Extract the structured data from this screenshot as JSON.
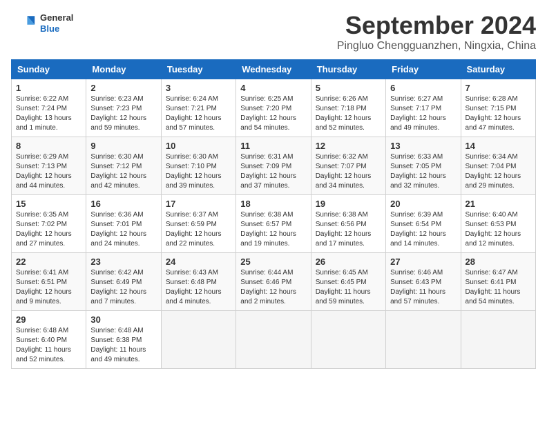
{
  "header": {
    "logo_general": "General",
    "logo_blue": "Blue",
    "title": "September 2024",
    "subtitle": "Pingluo Chengguanzhen, Ningxia, China"
  },
  "weekdays": [
    "Sunday",
    "Monday",
    "Tuesday",
    "Wednesday",
    "Thursday",
    "Friday",
    "Saturday"
  ],
  "weeks": [
    [
      {
        "day": "1",
        "sunrise": "6:22 AM",
        "sunset": "7:24 PM",
        "daylight": "13 hours and 1 minute."
      },
      {
        "day": "2",
        "sunrise": "6:23 AM",
        "sunset": "7:23 PM",
        "daylight": "12 hours and 59 minutes."
      },
      {
        "day": "3",
        "sunrise": "6:24 AM",
        "sunset": "7:21 PM",
        "daylight": "12 hours and 57 minutes."
      },
      {
        "day": "4",
        "sunrise": "6:25 AM",
        "sunset": "7:20 PM",
        "daylight": "12 hours and 54 minutes."
      },
      {
        "day": "5",
        "sunrise": "6:26 AM",
        "sunset": "7:18 PM",
        "daylight": "12 hours and 52 minutes."
      },
      {
        "day": "6",
        "sunrise": "6:27 AM",
        "sunset": "7:17 PM",
        "daylight": "12 hours and 49 minutes."
      },
      {
        "day": "7",
        "sunrise": "6:28 AM",
        "sunset": "7:15 PM",
        "daylight": "12 hours and 47 minutes."
      }
    ],
    [
      {
        "day": "8",
        "sunrise": "6:29 AM",
        "sunset": "7:13 PM",
        "daylight": "12 hours and 44 minutes."
      },
      {
        "day": "9",
        "sunrise": "6:30 AM",
        "sunset": "7:12 PM",
        "daylight": "12 hours and 42 minutes."
      },
      {
        "day": "10",
        "sunrise": "6:30 AM",
        "sunset": "7:10 PM",
        "daylight": "12 hours and 39 minutes."
      },
      {
        "day": "11",
        "sunrise": "6:31 AM",
        "sunset": "7:09 PM",
        "daylight": "12 hours and 37 minutes."
      },
      {
        "day": "12",
        "sunrise": "6:32 AM",
        "sunset": "7:07 PM",
        "daylight": "12 hours and 34 minutes."
      },
      {
        "day": "13",
        "sunrise": "6:33 AM",
        "sunset": "7:05 PM",
        "daylight": "12 hours and 32 minutes."
      },
      {
        "day": "14",
        "sunrise": "6:34 AM",
        "sunset": "7:04 PM",
        "daylight": "12 hours and 29 minutes."
      }
    ],
    [
      {
        "day": "15",
        "sunrise": "6:35 AM",
        "sunset": "7:02 PM",
        "daylight": "12 hours and 27 minutes."
      },
      {
        "day": "16",
        "sunrise": "6:36 AM",
        "sunset": "7:01 PM",
        "daylight": "12 hours and 24 minutes."
      },
      {
        "day": "17",
        "sunrise": "6:37 AM",
        "sunset": "6:59 PM",
        "daylight": "12 hours and 22 minutes."
      },
      {
        "day": "18",
        "sunrise": "6:38 AM",
        "sunset": "6:57 PM",
        "daylight": "12 hours and 19 minutes."
      },
      {
        "day": "19",
        "sunrise": "6:38 AM",
        "sunset": "6:56 PM",
        "daylight": "12 hours and 17 minutes."
      },
      {
        "day": "20",
        "sunrise": "6:39 AM",
        "sunset": "6:54 PM",
        "daylight": "12 hours and 14 minutes."
      },
      {
        "day": "21",
        "sunrise": "6:40 AM",
        "sunset": "6:53 PM",
        "daylight": "12 hours and 12 minutes."
      }
    ],
    [
      {
        "day": "22",
        "sunrise": "6:41 AM",
        "sunset": "6:51 PM",
        "daylight": "12 hours and 9 minutes."
      },
      {
        "day": "23",
        "sunrise": "6:42 AM",
        "sunset": "6:49 PM",
        "daylight": "12 hours and 7 minutes."
      },
      {
        "day": "24",
        "sunrise": "6:43 AM",
        "sunset": "6:48 PM",
        "daylight": "12 hours and 4 minutes."
      },
      {
        "day": "25",
        "sunrise": "6:44 AM",
        "sunset": "6:46 PM",
        "daylight": "12 hours and 2 minutes."
      },
      {
        "day": "26",
        "sunrise": "6:45 AM",
        "sunset": "6:45 PM",
        "daylight": "11 hours and 59 minutes."
      },
      {
        "day": "27",
        "sunrise": "6:46 AM",
        "sunset": "6:43 PM",
        "daylight": "11 hours and 57 minutes."
      },
      {
        "day": "28",
        "sunrise": "6:47 AM",
        "sunset": "6:41 PM",
        "daylight": "11 hours and 54 minutes."
      }
    ],
    [
      {
        "day": "29",
        "sunrise": "6:48 AM",
        "sunset": "6:40 PM",
        "daylight": "11 hours and 52 minutes."
      },
      {
        "day": "30",
        "sunrise": "6:48 AM",
        "sunset": "6:38 PM",
        "daylight": "11 hours and 49 minutes."
      },
      null,
      null,
      null,
      null,
      null
    ]
  ],
  "labels": {
    "sunrise": "Sunrise:",
    "sunset": "Sunset:",
    "daylight": "Daylight:"
  }
}
